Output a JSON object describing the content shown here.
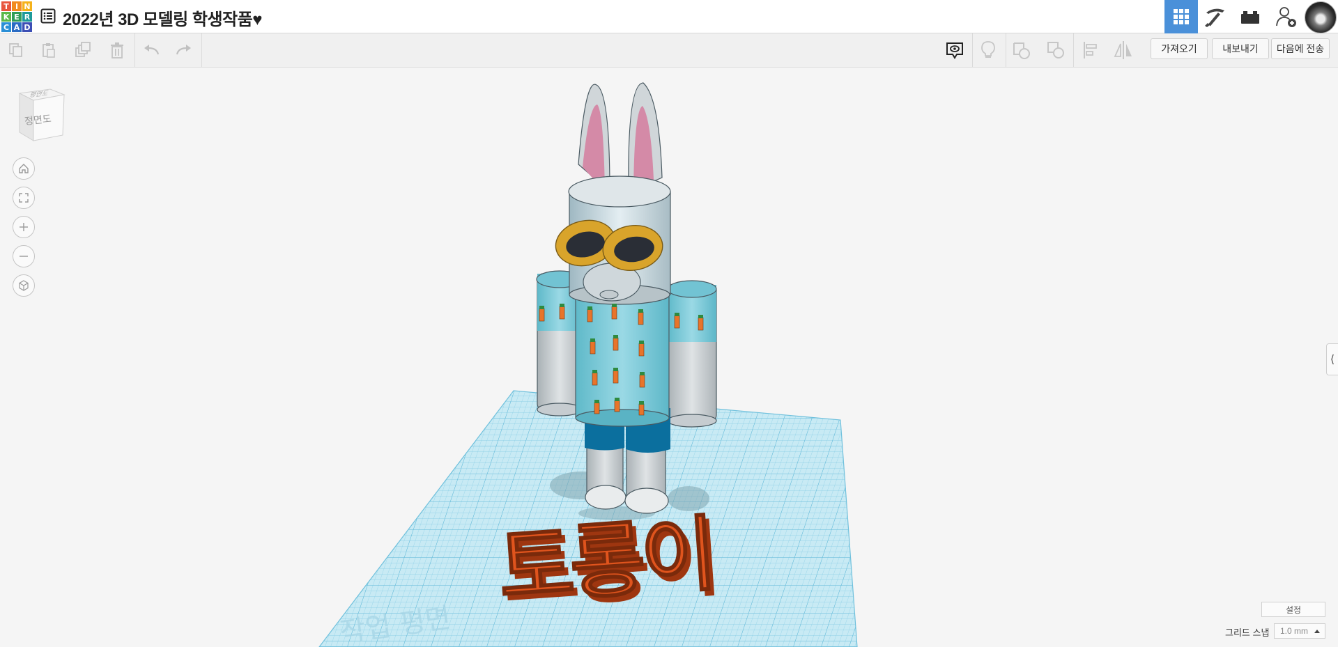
{
  "app": {
    "logo_letters": [
      "T",
      "I",
      "N",
      "K",
      "E",
      "R",
      "C",
      "A",
      "D"
    ],
    "logo_colors": [
      "#e8553e",
      "#f28b20",
      "#f5b21b",
      "#5bb84a",
      "#2f9d57",
      "#1e9a9a",
      "#2b8fd6",
      "#2b6cc4",
      "#3c4fb5"
    ],
    "accent_color": "#4a90d9",
    "design_title": "2022년 3D 모델링 학생작품♥"
  },
  "header": {
    "icons": [
      "design-menu-icon",
      "3d-design-view-icon",
      "pickaxe-icon",
      "bricks-icon",
      "invite-user-icon",
      "user-avatar"
    ]
  },
  "toolbar": {
    "icons": [
      "copy-icon",
      "paste-icon",
      "duplicate-icon",
      "delete-icon",
      "undo-icon",
      "redo-icon",
      "notes-icon",
      "light-bulb-icon",
      "group-icon",
      "ungroup-icon",
      "align-icon",
      "mirror-icon"
    ],
    "import_label": "가져오기",
    "export_label": "내보내기",
    "send_to_label": "다음에 전송"
  },
  "viewcube": {
    "face_label": "정면도",
    "top_label": "평면도"
  },
  "scene": {
    "text_object": "토롱이",
    "workplane_label": "작업 평면",
    "workplane_color": "#8fd3ea",
    "text_color": "#e0541d"
  },
  "bottom": {
    "settings_label": "설정",
    "grid_snap_label": "그리드 스냅",
    "grid_snap_value": "1.0 mm"
  }
}
